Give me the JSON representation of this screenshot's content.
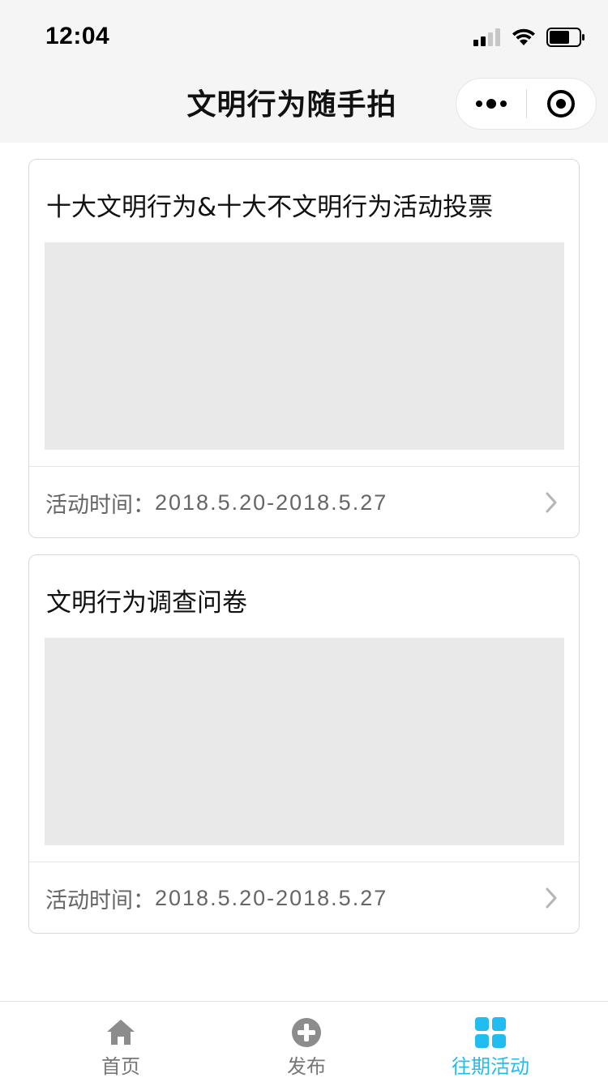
{
  "status_bar": {
    "time": "12:04"
  },
  "nav": {
    "title": "文明行为随手拍"
  },
  "cards": [
    {
      "title": "十大文明行为&十大不文明行为活动投票",
      "time_label": "活动时间：",
      "time_value": "2018.5.20-2018.5.27"
    },
    {
      "title": "文明行为调查问卷",
      "time_label": "活动时间：",
      "time_value": "2018.5.20-2018.5.27"
    }
  ],
  "tab_bar": {
    "tabs": [
      {
        "label": "首页",
        "icon": "home-icon",
        "active": false
      },
      {
        "label": "发布",
        "icon": "plus-circle-icon",
        "active": false
      },
      {
        "label": "往期活动",
        "icon": "grid-icon",
        "active": true
      }
    ]
  },
  "colors": {
    "accent": "#22bdf0",
    "inactive_icon": "#8c8c8c",
    "placeholder": "#e9e9e9"
  }
}
